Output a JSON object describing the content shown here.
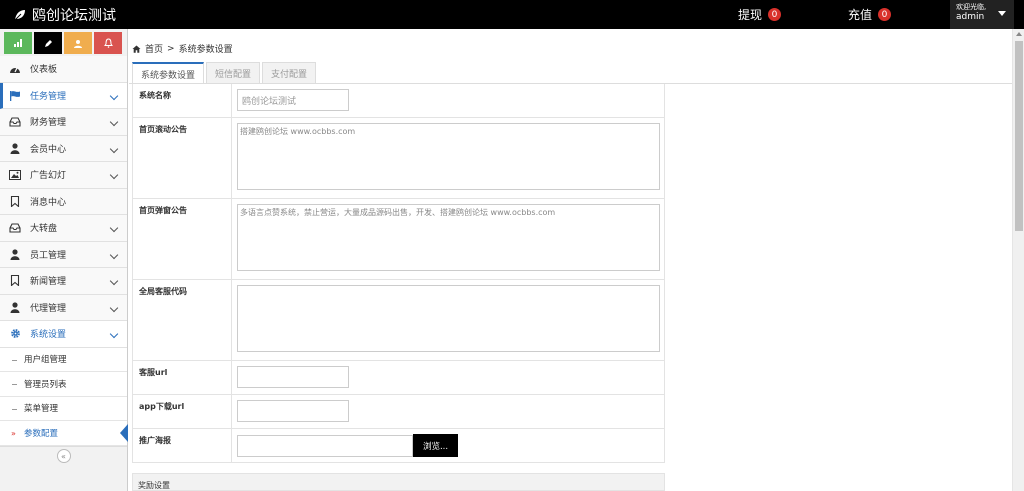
{
  "app": {
    "title": "鸥创论坛测试"
  },
  "topbar": {
    "withdraw_label": "提现",
    "withdraw_count": "0",
    "recharge_label": "充值",
    "recharge_count": "0",
    "welcome": "欢迎光临,",
    "username": "admin"
  },
  "sidebar": {
    "shortcut_colors": [
      "#5cb85c",
      "#000000",
      "#f0ad4e",
      "#d9534f"
    ],
    "items": [
      {
        "label": "仪表板",
        "icon": "dashboard-icon"
      },
      {
        "label": "任务管理",
        "icon": "flag-icon"
      },
      {
        "label": "财务管理",
        "icon": "inbox-icon"
      },
      {
        "label": "会员中心",
        "icon": "user-icon"
      },
      {
        "label": "广告幻灯",
        "icon": "picture-icon"
      },
      {
        "label": "消息中心",
        "icon": "bookmark-icon"
      },
      {
        "label": "大转盘",
        "icon": "inbox-icon"
      },
      {
        "label": "员工管理",
        "icon": "user-icon"
      },
      {
        "label": "新闻管理",
        "icon": "bookmark-icon"
      },
      {
        "label": "代理管理",
        "icon": "user-icon"
      },
      {
        "label": "系统设置",
        "icon": "gear-icon"
      }
    ],
    "sub_items": [
      "用户组管理",
      "管理员列表",
      "菜单管理",
      "参数配置"
    ],
    "collapse_glyph": "«"
  },
  "breadcrumb": {
    "home": "首页",
    "sep": ">",
    "current": "系统参数设置"
  },
  "tabs": [
    "系统参数设置",
    "短信配置",
    "支付配置"
  ],
  "form": {
    "site_name_label": "系统名称",
    "site_name_value": "鸥创论坛测试",
    "scroll_notice_label": "首页滚动公告",
    "scroll_notice_value": "搭建鸥创论坛 www.ocbbs.com",
    "popup_notice_label": "首页弹窗公告",
    "popup_notice_value": "多语言点赞系统，禁止营运，大量成品源码出售，开发、搭建鸥创论坛 www.ocbbs.com",
    "service_code_label": "全局客服代码",
    "service_code_value": "",
    "service_url_label": "客服url",
    "service_url_value": "",
    "app_url_label": "app下载url",
    "app_url_value": "",
    "poster_label": "推广海报",
    "browse_label": "浏览..."
  },
  "reward_section": "奖励设置",
  "colors": {
    "accent": "#2a6ebb",
    "badge": "#d9312b",
    "topbar": "#000000"
  }
}
